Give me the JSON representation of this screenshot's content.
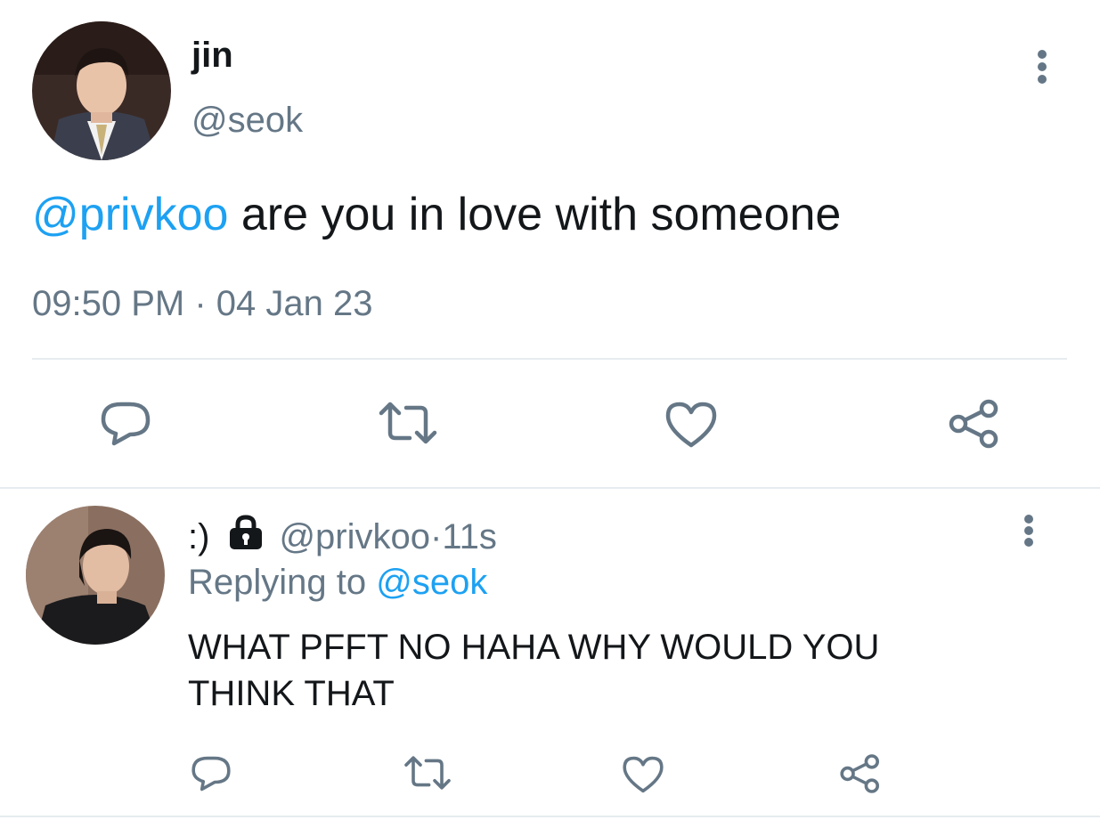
{
  "main_tweet": {
    "display_name": "jin",
    "handle": "@seok",
    "mention": "@privkoo",
    "text": " are you in love with someone",
    "time": "09:50 PM",
    "separator": " · ",
    "date": "04 Jan 23",
    "avatar_icon": "profile-photo",
    "actions": [
      "reply-icon",
      "retweet-icon",
      "like-icon",
      "share-icon"
    ]
  },
  "reply_tweet": {
    "display_name": ":)",
    "lock_icon": "lock-icon",
    "handle": "@privkoo",
    "separator": " · ",
    "age": "11s",
    "replying_label": "Replying to",
    "replying_to": "@seok",
    "text": "WHAT PFFT NO HAHA WHY WOULD YOU THINK THAT",
    "avatar_icon": "profile-photo",
    "actions": [
      "reply-icon",
      "retweet-icon",
      "like-icon",
      "share-icon"
    ]
  },
  "colors": {
    "text": "#14171a",
    "muted": "#657786",
    "link": "#1da1f2",
    "divider": "#e6ecf0"
  }
}
